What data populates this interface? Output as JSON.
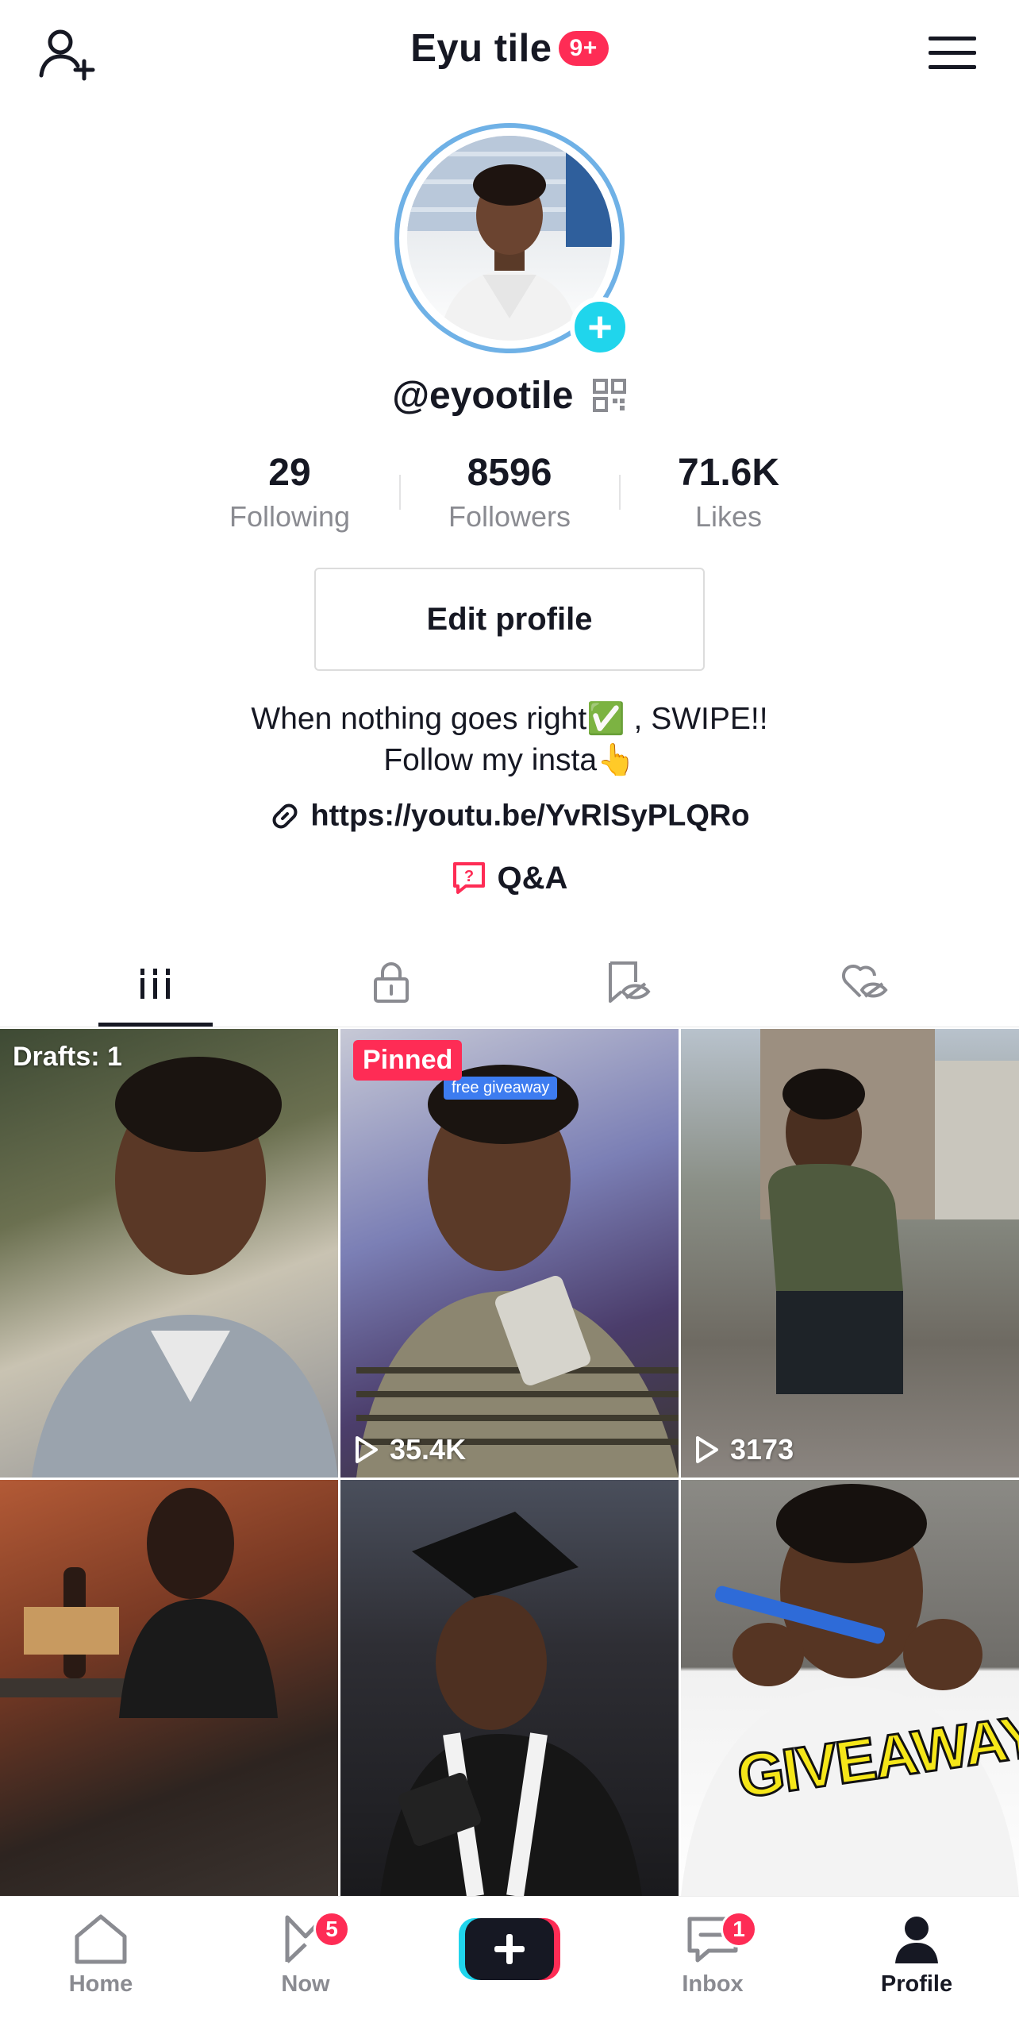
{
  "header": {
    "title": "Eyu tile",
    "notification_badge": "9+",
    "add_friend_icon": "person-plus-icon",
    "menu_icon": "hamburger-menu-icon"
  },
  "profile": {
    "username": "@eyootile",
    "qr_icon": "qr-code-icon",
    "stats": [
      {
        "value": "29",
        "label": "Following"
      },
      {
        "value": "8596",
        "label": "Followers"
      },
      {
        "value": "71.6K",
        "label": "Likes"
      }
    ],
    "edit_button": "Edit profile",
    "bio_line1": "When nothing goes right✅ , SWIPE!!",
    "bio_line2": "Follow my insta👆",
    "link": "https://youtu.be/YvRlSyPLQRo",
    "qa_label": "Q&A"
  },
  "tabs": [
    {
      "name": "videos",
      "icon": "grid-bars-icon",
      "active": true
    },
    {
      "name": "private",
      "icon": "lock-icon",
      "active": false
    },
    {
      "name": "reposts",
      "icon": "bookmark-eye-icon",
      "active": false
    },
    {
      "name": "liked",
      "icon": "heart-eye-icon",
      "active": false
    }
  ],
  "videos": [
    {
      "label": "Drafts: 1",
      "views": "",
      "pinned": false
    },
    {
      "label": "Pinned",
      "views": "35.4K",
      "pinned": true,
      "caption": "free giveaway"
    },
    {
      "label": "",
      "views": "3173",
      "pinned": false
    },
    {
      "label": "",
      "views": "",
      "pinned": false
    },
    {
      "label": "",
      "views": "",
      "pinned": false
    },
    {
      "label": "",
      "views": "",
      "pinned": false,
      "overlay_text": "GIVEAWAY"
    }
  ],
  "bottom_nav": [
    {
      "label": "Home",
      "icon": "home-icon",
      "badge": ""
    },
    {
      "label": "Now",
      "icon": "now-icon",
      "badge": "5"
    },
    {
      "label": "",
      "icon": "create-plus-icon",
      "badge": ""
    },
    {
      "label": "Inbox",
      "icon": "inbox-icon",
      "badge": "1"
    },
    {
      "label": "Profile",
      "icon": "profile-icon",
      "badge": ""
    }
  ],
  "colors": {
    "accent": "#fe2c55",
    "avatar_ring": "#6fb1e6",
    "avatar_plus": "#20d5ec",
    "text_primary": "#161823",
    "text_secondary": "#8a8b91"
  }
}
